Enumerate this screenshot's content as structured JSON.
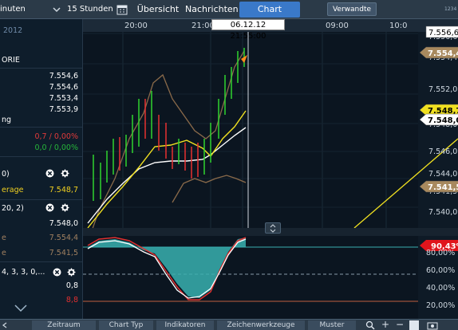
{
  "topbar": {
    "interval_left": "inuten",
    "interval": "15 Stunden",
    "tabs": [
      "Übersicht",
      "Nachrichten",
      "Chart"
    ],
    "active_tab": "Chart",
    "related_button": "Verwandte",
    "right_num": "1234"
  },
  "left": {
    "date_label": "2012",
    "category": "ORIE",
    "values": [
      "7.554,6",
      "7.554,6",
      "7.553,4",
      "7.553,9"
    ],
    "mid_label": "ng",
    "change_red": "0,7 / 0,00%",
    "change_green": "0,0 / 0,00%",
    "ind1_label": "0)",
    "ind1_sub_label": "erage",
    "ind1_value": "7.548,7",
    "ind2_label": "20, 2)",
    "ind2_values": [
      "7.548,0",
      "7.554,4",
      "7.541,5"
    ],
    "ind2_sub_labels": [
      "e",
      "e"
    ],
    "ind3_label": "4, 3, 3, 0,...",
    "ind3_value": "0,8",
    "ind3_value2": "8,8"
  },
  "chart": {
    "time_labels": [
      "20:00",
      "21:00",
      "09:00",
      "10:0"
    ],
    "crosshair_time": "06.12.12 21:55:00",
    "price_labels": [
      "7.556,6",
      "7.554,4",
      "7.552,0",
      "7.548,7",
      "7.548,0",
      "7.546,0",
      "7.544,0",
      "7.541,5",
      "7.540,0"
    ],
    "osc_top_value": "90,43%",
    "osc_labels": [
      "80,00%",
      "60,00%",
      "40,00%",
      "20,00%"
    ],
    "colors": {
      "up": "#2fd52f",
      "down": "#e83030",
      "yellow": "#f0e020",
      "white": "#ffffff",
      "bands": "#8a6a4a",
      "osc_fill": "#38b0b0",
      "osc_red": "#e03030"
    }
  },
  "bottombar": {
    "items": [
      "Zeitraum",
      "Chart Typ",
      "Indikatoren",
      "Zeichenwerkzeuge",
      "Muster"
    ]
  }
}
